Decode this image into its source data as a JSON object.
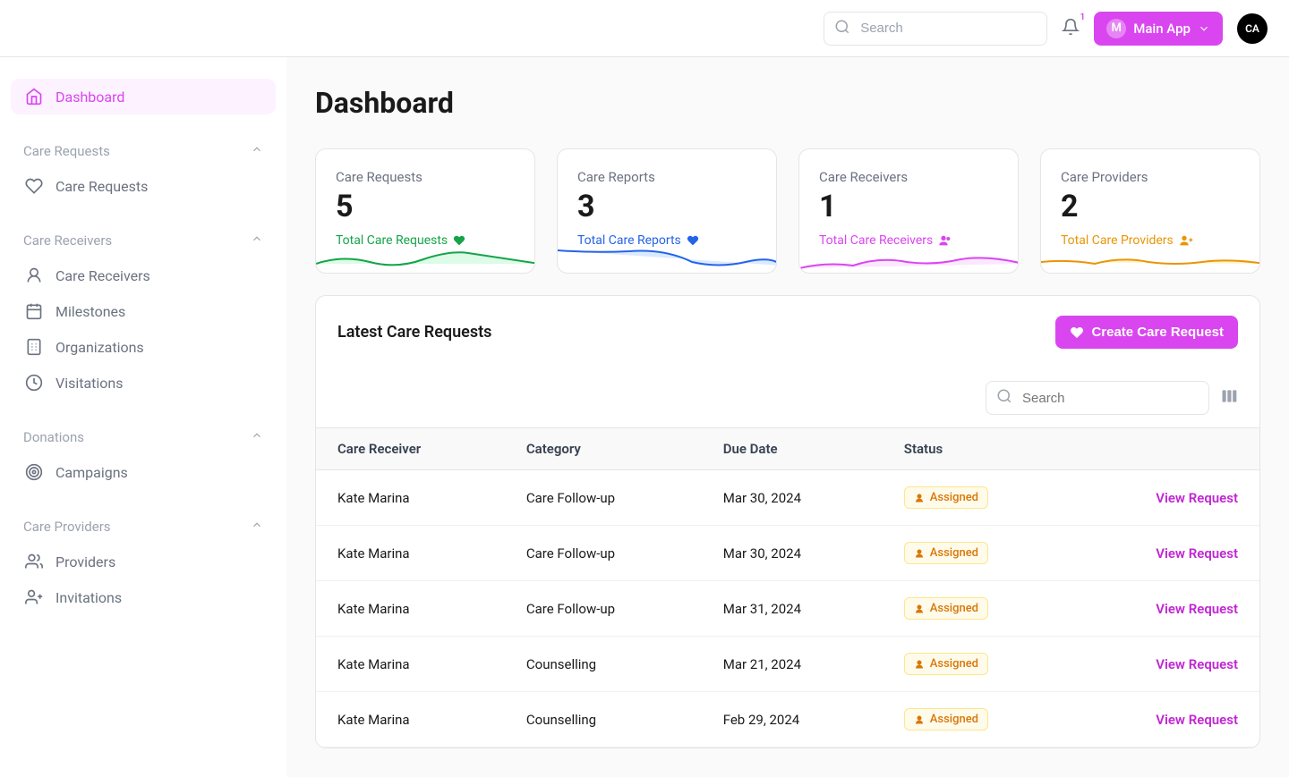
{
  "header": {
    "search_placeholder": "Search",
    "notification_count": "1",
    "app_badge": "M",
    "app_label": "Main App",
    "avatar": "CA"
  },
  "sidebar": {
    "dashboard_label": "Dashboard",
    "sections": {
      "care_requests": {
        "title": "Care Requests",
        "items": {
          "care_requests": "Care Requests"
        }
      },
      "care_receivers": {
        "title": "Care Receivers",
        "items": {
          "care_receivers": "Care Receivers",
          "milestones": "Milestones",
          "organizations": "Organizations",
          "visitations": "Visitations"
        }
      },
      "donations": {
        "title": "Donations",
        "items": {
          "campaigns": "Campaigns"
        }
      },
      "care_providers": {
        "title": "Care Providers",
        "items": {
          "providers": "Providers",
          "invitations": "Invitations"
        }
      }
    }
  },
  "page": {
    "title": "Dashboard",
    "stats": {
      "care_requests": {
        "label": "Care Requests",
        "value": "5",
        "footer": "Total Care Requests"
      },
      "care_reports": {
        "label": "Care Reports",
        "value": "3",
        "footer": "Total Care Reports"
      },
      "care_receivers": {
        "label": "Care Receivers",
        "value": "1",
        "footer": "Total Care Receivers"
      },
      "care_providers": {
        "label": "Care Providers",
        "value": "2",
        "footer": "Total Care Providers"
      }
    }
  },
  "panel": {
    "title": "Latest Care Requests",
    "create_label": "Create Care Request",
    "search_placeholder": "Search",
    "columns": {
      "care_receiver": "Care Receiver",
      "category": "Category",
      "due_date": "Due Date",
      "status": "Status"
    },
    "rows": [
      {
        "receiver": "Kate Marina",
        "category": "Care Follow-up",
        "due": "Mar 30, 2024",
        "status": "Assigned",
        "action": "View Request"
      },
      {
        "receiver": "Kate Marina",
        "category": "Care Follow-up",
        "due": "Mar 30, 2024",
        "status": "Assigned",
        "action": "View Request"
      },
      {
        "receiver": "Kate Marina",
        "category": "Care Follow-up",
        "due": "Mar 31, 2024",
        "status": "Assigned",
        "action": "View Request"
      },
      {
        "receiver": "Kate Marina",
        "category": "Counselling",
        "due": "Mar 21, 2024",
        "status": "Assigned",
        "action": "View Request"
      },
      {
        "receiver": "Kate Marina",
        "category": "Counselling",
        "due": "Feb 29, 2024",
        "status": "Assigned",
        "action": "View Request"
      }
    ]
  }
}
